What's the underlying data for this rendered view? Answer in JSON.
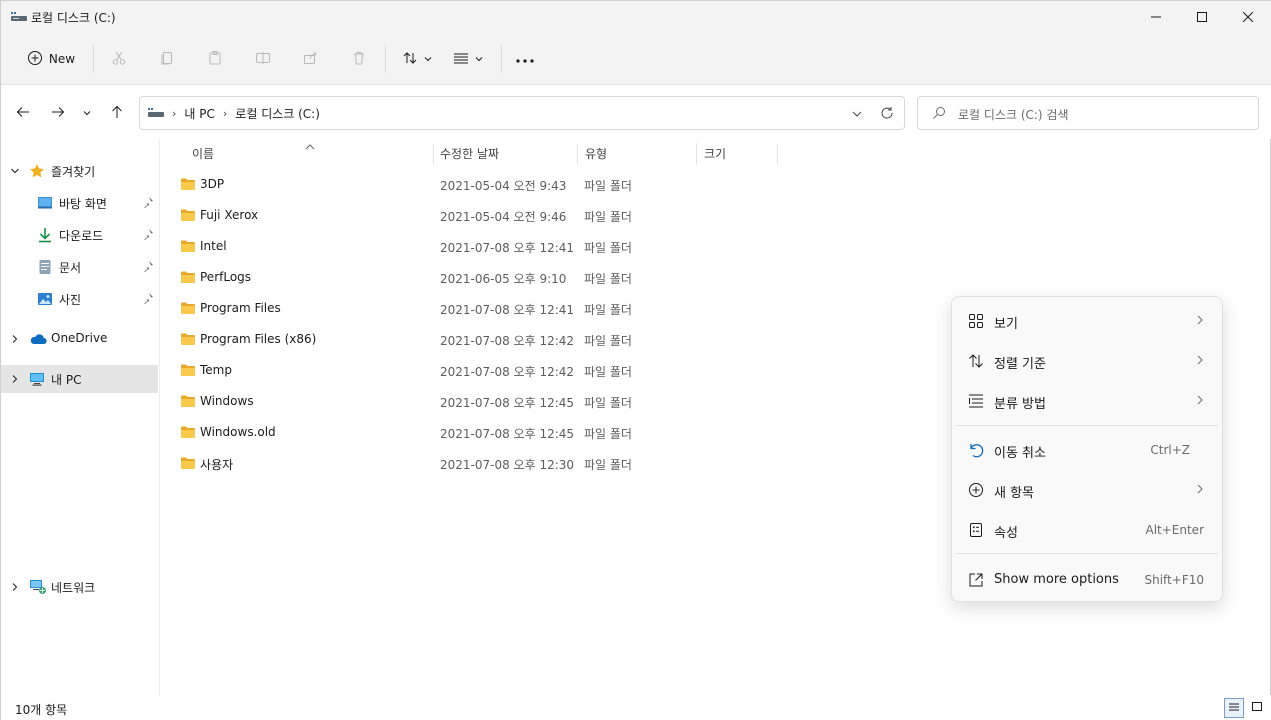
{
  "window": {
    "title": "로컬 디스크 (C:)"
  },
  "commandbar": {
    "new_label": "New",
    "icons": [
      "cut-icon",
      "copy-icon",
      "paste-icon",
      "rename-icon",
      "share-icon",
      "delete-icon",
      "sort-icon",
      "view-icon",
      "more-icon"
    ]
  },
  "address": {
    "crumbs": [
      "내 PC",
      "로컬 디스크 (C:)"
    ]
  },
  "search": {
    "placeholder": "로컬 디스크 (C:) 검색"
  },
  "sidebar": {
    "favorites_label": "즐겨찾기",
    "items": [
      {
        "label": "바탕 화면",
        "icon": "desktop-icon"
      },
      {
        "label": "다운로드",
        "icon": "download-icon"
      },
      {
        "label": "문서",
        "icon": "document-icon"
      },
      {
        "label": "사진",
        "icon": "pictures-icon"
      }
    ],
    "onedrive_label": "OneDrive",
    "thispc_label": "내 PC",
    "network_label": "네트워크"
  },
  "columns": {
    "name": "이름",
    "date": "수정한 날짜",
    "type": "유형",
    "size": "크기"
  },
  "files": [
    {
      "name": "3DP",
      "date": "2021-05-04 오전 9:43",
      "type": "파일 폴더"
    },
    {
      "name": "Fuji Xerox",
      "date": "2021-05-04 오전 9:46",
      "type": "파일 폴더"
    },
    {
      "name": "Intel",
      "date": "2021-07-08 오후 12:41",
      "type": "파일 폴더"
    },
    {
      "name": "PerfLogs",
      "date": "2021-06-05 오후 9:10",
      "type": "파일 폴더"
    },
    {
      "name": "Program Files",
      "date": "2021-07-08 오후 12:41",
      "type": "파일 폴더"
    },
    {
      "name": "Program Files (x86)",
      "date": "2021-07-08 오후 12:42",
      "type": "파일 폴더"
    },
    {
      "name": "Temp",
      "date": "2021-07-08 오후 12:42",
      "type": "파일 폴더"
    },
    {
      "name": "Windows",
      "date": "2021-07-08 오후 12:45",
      "type": "파일 폴더"
    },
    {
      "name": "Windows.old",
      "date": "2021-07-08 오후 12:45",
      "type": "파일 폴더"
    },
    {
      "name": "사용자",
      "date": "2021-07-08 오후 12:30",
      "type": "파일 폴더"
    }
  ],
  "status": {
    "count_text": "10개 항목"
  },
  "context_menu": {
    "items": [
      {
        "label": "보기",
        "icon": "view-grid-icon",
        "submenu": true,
        "shortcut": ""
      },
      {
        "label": "정렬 기준",
        "icon": "sort-icon",
        "submenu": true,
        "shortcut": ""
      },
      {
        "label": "분류 방법",
        "icon": "group-icon",
        "submenu": true,
        "shortcut": ""
      },
      {
        "label": "이동 취소",
        "icon": "undo-icon",
        "submenu": false,
        "shortcut": "Ctrl+Z"
      },
      {
        "label": "새 항목",
        "icon": "new-item-icon",
        "submenu": true,
        "shortcut": ""
      },
      {
        "label": "속성",
        "icon": "properties-icon",
        "submenu": false,
        "shortcut": "Alt+Enter"
      },
      {
        "label": "Show more options",
        "icon": "show-more-icon",
        "submenu": false,
        "shortcut": "Shift+F10"
      }
    ]
  },
  "colors": {
    "accent": "#0067c0",
    "folder": "#f8c94a",
    "chrome": "#f3f3f3",
    "selected": "#e5e5e5"
  }
}
